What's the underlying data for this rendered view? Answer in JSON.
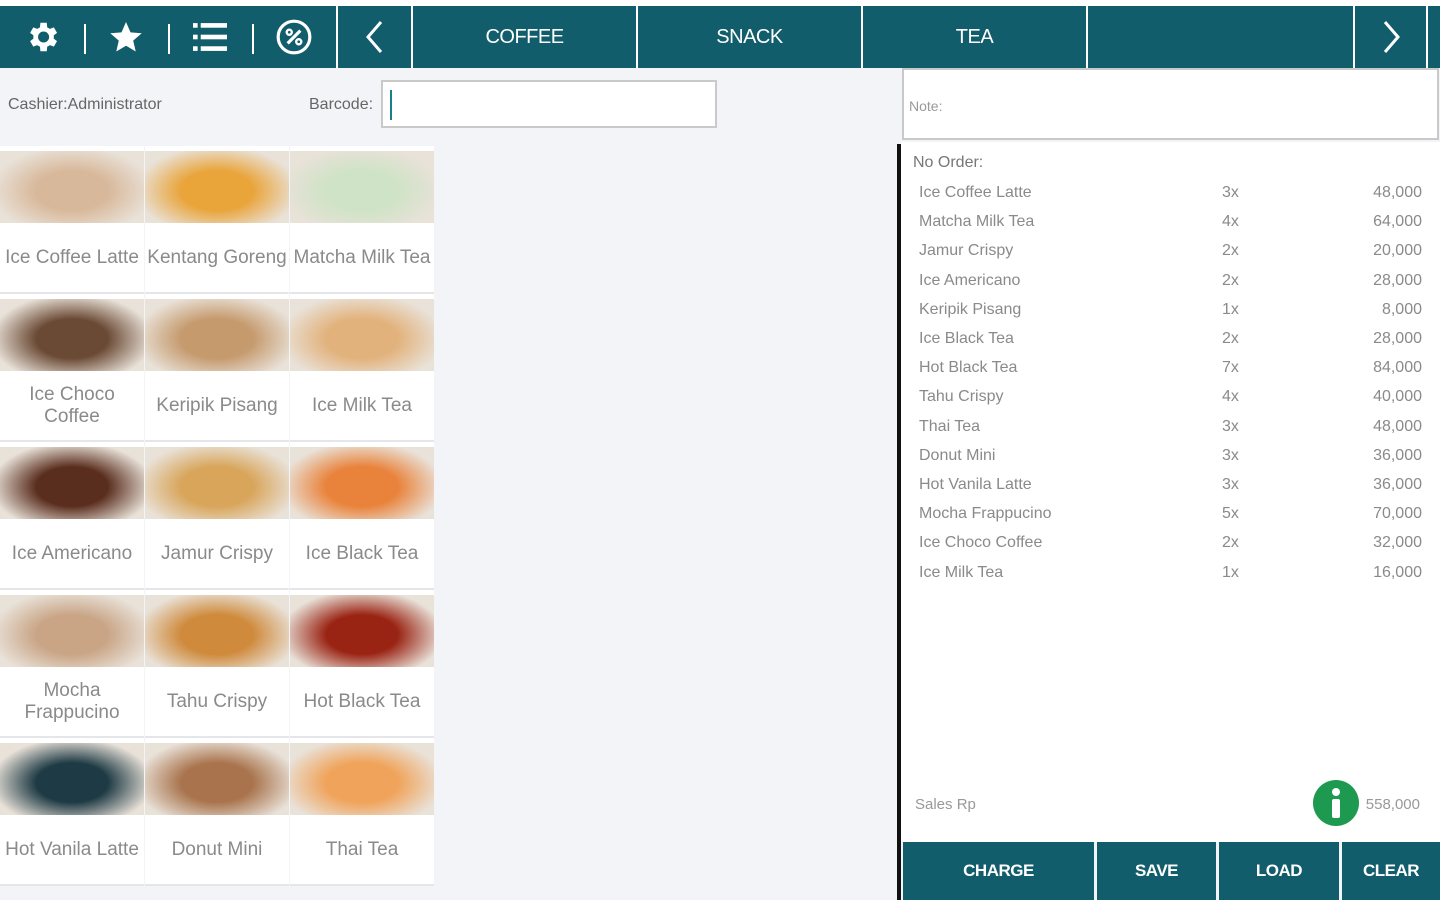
{
  "toolbar": {
    "icons": [
      "gear-icon",
      "star-icon",
      "list-icon",
      "percent-icon"
    ],
    "prev_icon": "chevron-left-icon",
    "next_icon": "chevron-right-icon",
    "categories": [
      "COFFEE",
      "SNACK",
      "TEA",
      ""
    ]
  },
  "header": {
    "cashier": "Cashier:Administrator",
    "barcode_label": "Barcode:",
    "barcode_value": ""
  },
  "products": [
    {
      "name": "Ice Coffee Latte",
      "color": "#d8b89a"
    },
    {
      "name": "Kentang Goreng",
      "color": "#e9a43a"
    },
    {
      "name": "Matcha Milk Tea",
      "color": "#cfe3c6"
    },
    {
      "name": "Ice Choco Coffee",
      "color": "#6b4a35"
    },
    {
      "name": "Keripik Pisang",
      "color": "#c59a6d"
    },
    {
      "name": "Ice Milk Tea",
      "color": "#e2b27c"
    },
    {
      "name": "Ice Americano",
      "color": "#5a2e1e"
    },
    {
      "name": "Jamur Crispy",
      "color": "#d8a55a"
    },
    {
      "name": "Ice Black Tea",
      "color": "#e9823a"
    },
    {
      "name": "Mocha Frappucino",
      "color": "#c9a586"
    },
    {
      "name": "Tahu Crispy",
      "color": "#cf8a3b"
    },
    {
      "name": "Hot Black Tea",
      "color": "#9a2414"
    },
    {
      "name": "Hot Vanila Latte",
      "color": "#1e3a44"
    },
    {
      "name": "Donut Mini",
      "color": "#a9744d"
    },
    {
      "name": "Thai Tea",
      "color": "#f0a35a"
    }
  ],
  "note": {
    "label": "Note:"
  },
  "order": {
    "title": "No Order:",
    "items": [
      {
        "name": "Ice Coffee Latte",
        "qty": "3x",
        "price": "48,000"
      },
      {
        "name": "Matcha Milk Tea",
        "qty": "4x",
        "price": "64,000"
      },
      {
        "name": "Jamur Crispy",
        "qty": "2x",
        "price": "20,000"
      },
      {
        "name": "Ice Americano",
        "qty": "2x",
        "price": "28,000"
      },
      {
        "name": "Keripik Pisang",
        "qty": "1x",
        "price": "8,000"
      },
      {
        "name": "Ice Black Tea",
        "qty": "2x",
        "price": "28,000"
      },
      {
        "name": "Hot Black Tea",
        "qty": "7x",
        "price": "84,000"
      },
      {
        "name": "Tahu Crispy",
        "qty": "4x",
        "price": "40,000"
      },
      {
        "name": "Thai Tea",
        "qty": "3x",
        "price": "48,000"
      },
      {
        "name": "Donut Mini",
        "qty": "3x",
        "price": "36,000"
      },
      {
        "name": "Hot Vanila Latte",
        "qty": "3x",
        "price": "36,000"
      },
      {
        "name": "Mocha Frappucino",
        "qty": "5x",
        "price": "70,000"
      },
      {
        "name": "Ice Choco Coffee",
        "qty": "2x",
        "price": "32,000"
      },
      {
        "name": "Ice Milk Tea",
        "qty": "1x",
        "price": "16,000"
      }
    ],
    "sales_label": "Sales Rp",
    "sales_total": "558,000",
    "info_icon": "info-icon"
  },
  "actions": {
    "charge": "CHARGE",
    "save": "SAVE",
    "load": "LOAD",
    "clear": "CLEAR"
  },
  "colors": {
    "primary": "#125d6b",
    "info": "#1e9a50"
  }
}
